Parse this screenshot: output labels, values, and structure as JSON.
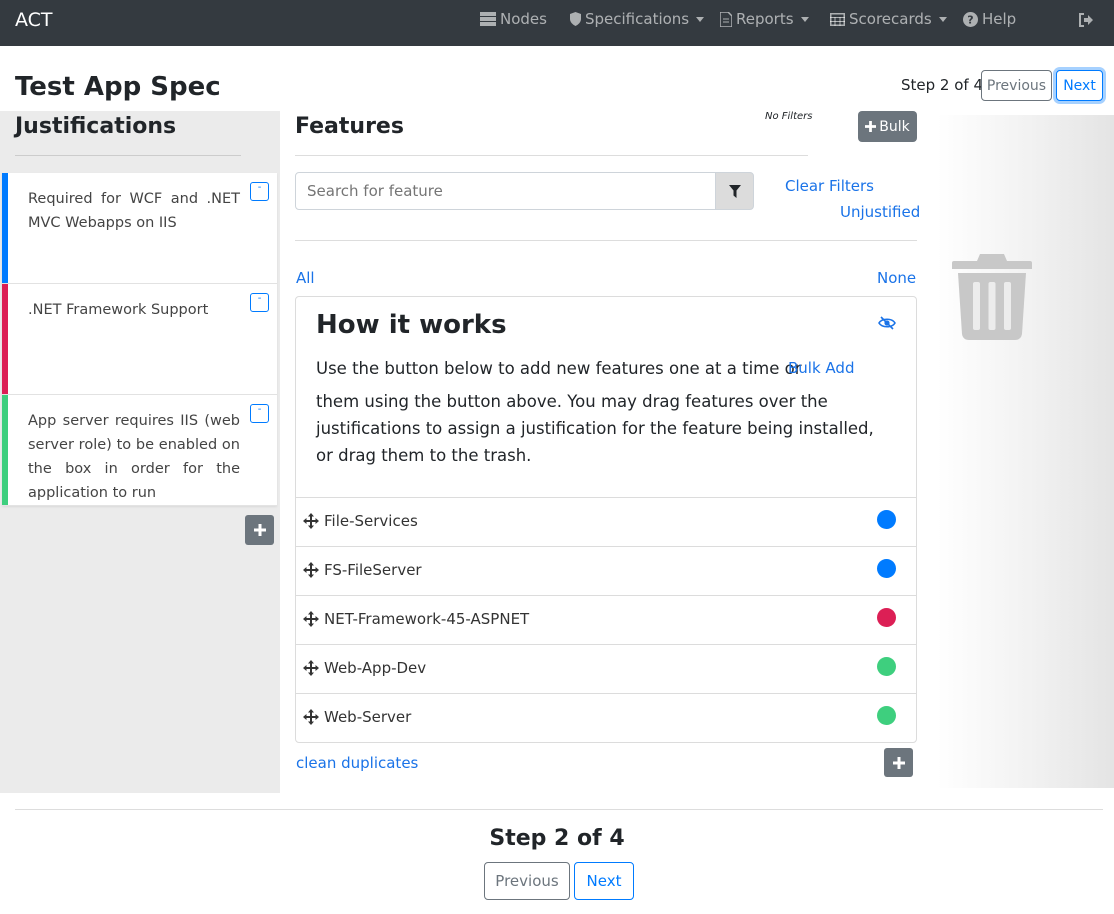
{
  "nav": {
    "brand": "ACT",
    "items": [
      {
        "label": "Nodes",
        "icon": "server-icon",
        "dropdown": false
      },
      {
        "label": "Specifications",
        "icon": "shield-icon",
        "dropdown": true
      },
      {
        "label": "Reports",
        "icon": "file-icon",
        "dropdown": true
      },
      {
        "label": "Scorecards",
        "icon": "table-icon",
        "dropdown": true
      },
      {
        "label": "Help",
        "icon": "question-circle-icon",
        "dropdown": false
      }
    ],
    "signout_icon": "sign-out-icon"
  },
  "page": {
    "title": "Test App Spec",
    "step_label": "Step 2 of 4",
    "previous_label": "Previous",
    "next_label": "Next"
  },
  "justifications": {
    "title": "Justifications",
    "items": [
      {
        "text": "Required for WCF and .NET MVC Webapps on IIS",
        "color": "#007bff"
      },
      {
        "text": ".NET Framework Support",
        "color": "#dc1f55"
      },
      {
        "text": "App server requires IIS (web server role) to be enabled on the box in order for the application to run",
        "color": "#3ecf7e"
      }
    ],
    "collapse_label": "-"
  },
  "features": {
    "title": "Features",
    "no_filters": "No Filters",
    "bulk_label": "Bulk",
    "search_placeholder": "Search for feature",
    "clear_filters": "Clear Filters",
    "unjustified": "Unjustified",
    "all": "All",
    "none": "None",
    "how": {
      "title": "How it works",
      "p1": "Use the button below to add new features one at a time or",
      "bulk_add": "Bulk Add",
      "p2": "them using the button above. You may drag features over the justifications to assign a justification for the feature being installed, or drag them to the trash."
    },
    "rows": [
      {
        "name": "File-Services",
        "color": "#007bff"
      },
      {
        "name": "FS-FileServer",
        "color": "#007bff"
      },
      {
        "name": "NET-Framework-45-ASPNET",
        "color": "#dc1f55"
      },
      {
        "name": "Web-App-Dev",
        "color": "#3ecf7e"
      },
      {
        "name": "Web-Server",
        "color": "#3ecf7e"
      }
    ],
    "clean_duplicates": "clean duplicates"
  },
  "trash_icon": "trash-icon"
}
